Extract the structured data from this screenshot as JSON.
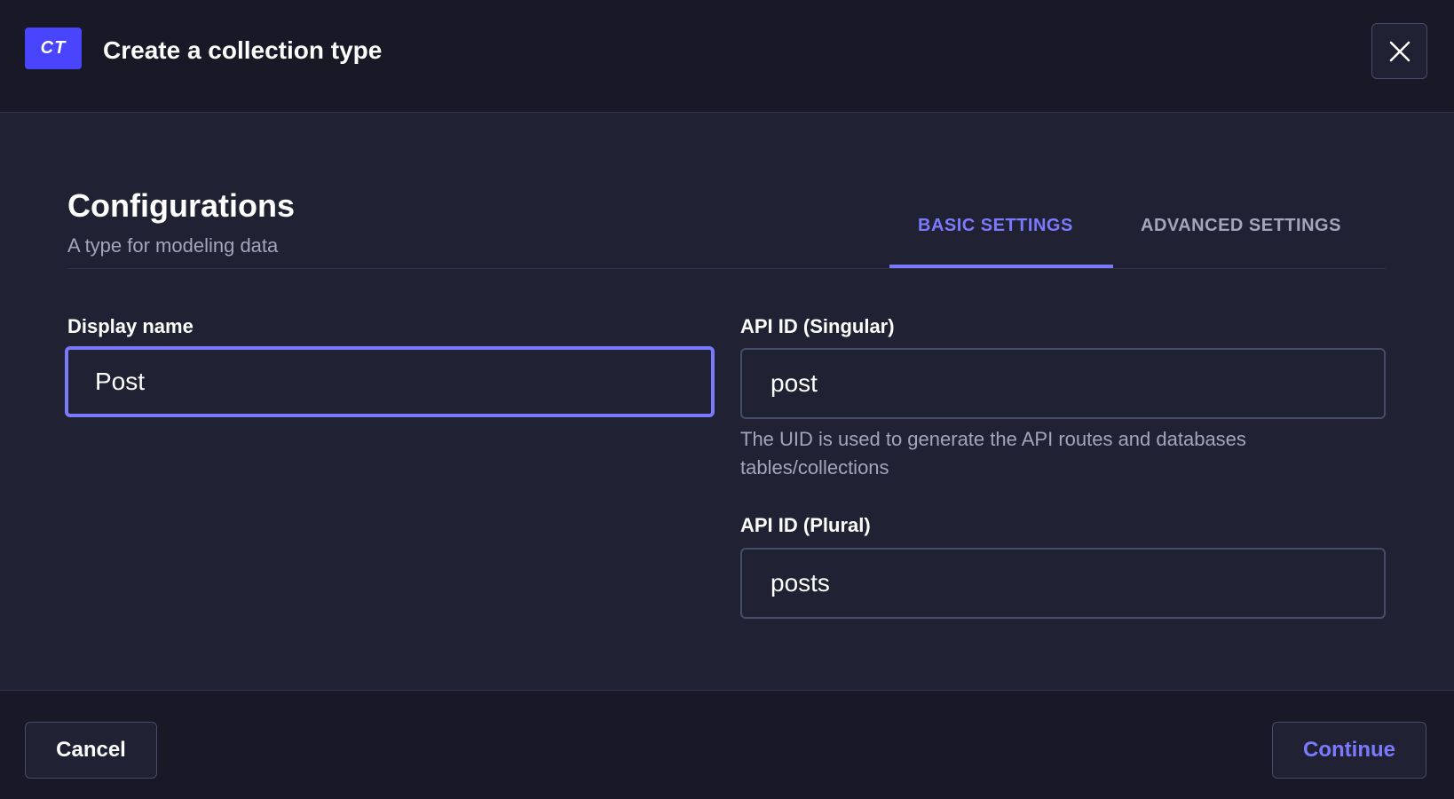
{
  "header": {
    "badge": "CT",
    "title": "Create a collection type"
  },
  "section": {
    "title": "Configurations",
    "subtitle": "A type for modeling data"
  },
  "tabs": [
    {
      "label": "BASIC SETTINGS",
      "active": true
    },
    {
      "label": "ADVANCED SETTINGS",
      "active": false
    }
  ],
  "fields": {
    "display_name": {
      "label": "Display name",
      "value": "Post"
    },
    "api_id_singular": {
      "label": "API ID (Singular)",
      "value": "post",
      "hint": "The UID is used to generate the API routes and databases tables/collections"
    },
    "api_id_plural": {
      "label": "API ID (Plural)",
      "value": "posts"
    }
  },
  "footer": {
    "cancel_label": "Cancel",
    "continue_label": "Continue"
  },
  "colors": {
    "accent": "#7b79ff",
    "badge_bg": "#4945ff",
    "background": "#212134",
    "header_bg": "#181826"
  },
  "icons": {
    "close": "close-icon"
  }
}
